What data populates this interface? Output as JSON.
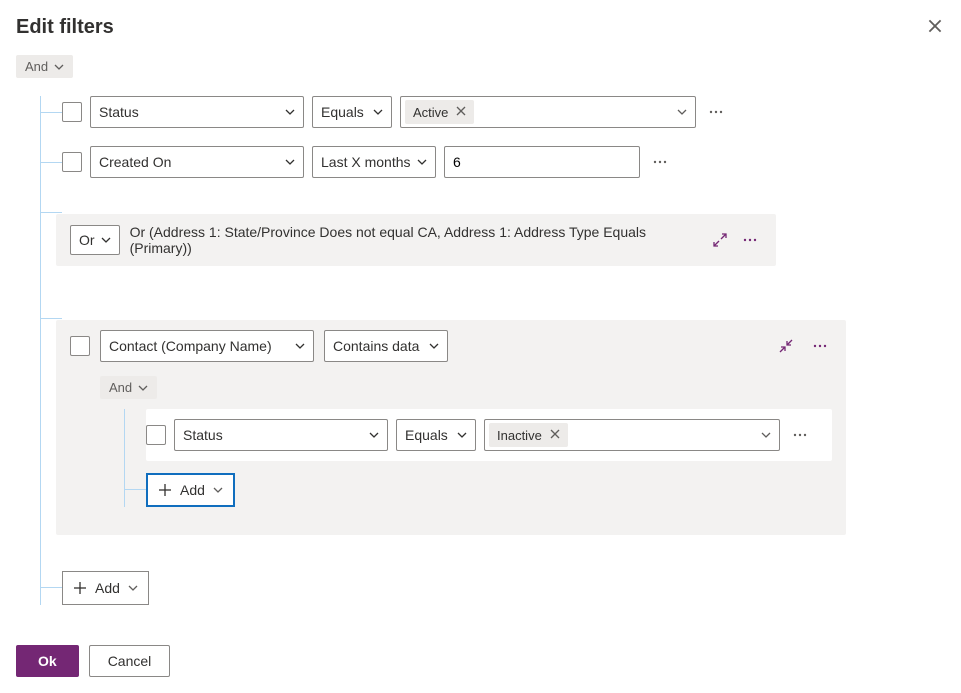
{
  "header": {
    "title": "Edit filters"
  },
  "root_operator": "And",
  "rows": [
    {
      "field": "Status",
      "operator": "Equals",
      "value_tag": "Active"
    },
    {
      "field": "Created On",
      "operator": "Last X months",
      "value_text": "6"
    }
  ],
  "or_group": {
    "op_label": "Or",
    "summary": "Or (Address 1: State/Province Does not equal CA, Address 1: Address Type Equals (Primary))"
  },
  "related": {
    "entity": "Contact (Company Name)",
    "operator": "Contains data",
    "nested_operator": "And",
    "row": {
      "field": "Status",
      "operator": "Equals",
      "value_tag": "Inactive"
    },
    "add_label": "Add"
  },
  "add_label": "Add",
  "footer": {
    "ok": "Ok",
    "cancel": "Cancel"
  }
}
